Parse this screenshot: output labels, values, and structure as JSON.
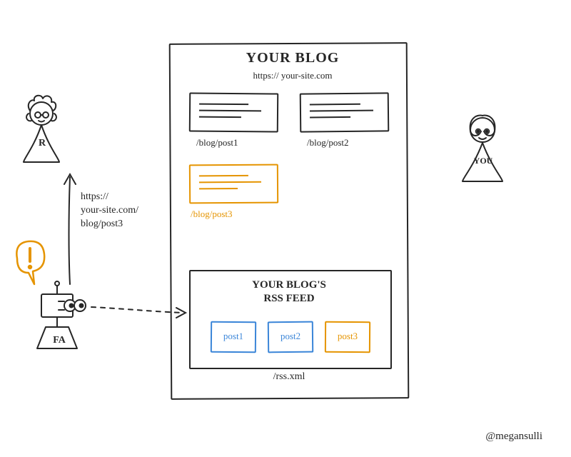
{
  "blog": {
    "title": "YOUR BLOG",
    "url": "https:// your-site.com",
    "posts": [
      {
        "label": "/blog/post1"
      },
      {
        "label": "/blog/post2"
      },
      {
        "label": "/blog/post3"
      }
    ],
    "rss": {
      "title_line1": "YOUR BLOG'S",
      "title_line2": "RSS FEED",
      "items": [
        {
          "label": "post1"
        },
        {
          "label": "post2"
        },
        {
          "label": "post3"
        }
      ],
      "path": "/rss.xml"
    }
  },
  "notification": {
    "url_line1": "https://",
    "url_line2": "your-site.com/",
    "url_line3": "blog/post3"
  },
  "characters": {
    "reader_label": "R",
    "robot_label": "FA",
    "you_label": "YOU"
  },
  "signature": "@megansulli"
}
